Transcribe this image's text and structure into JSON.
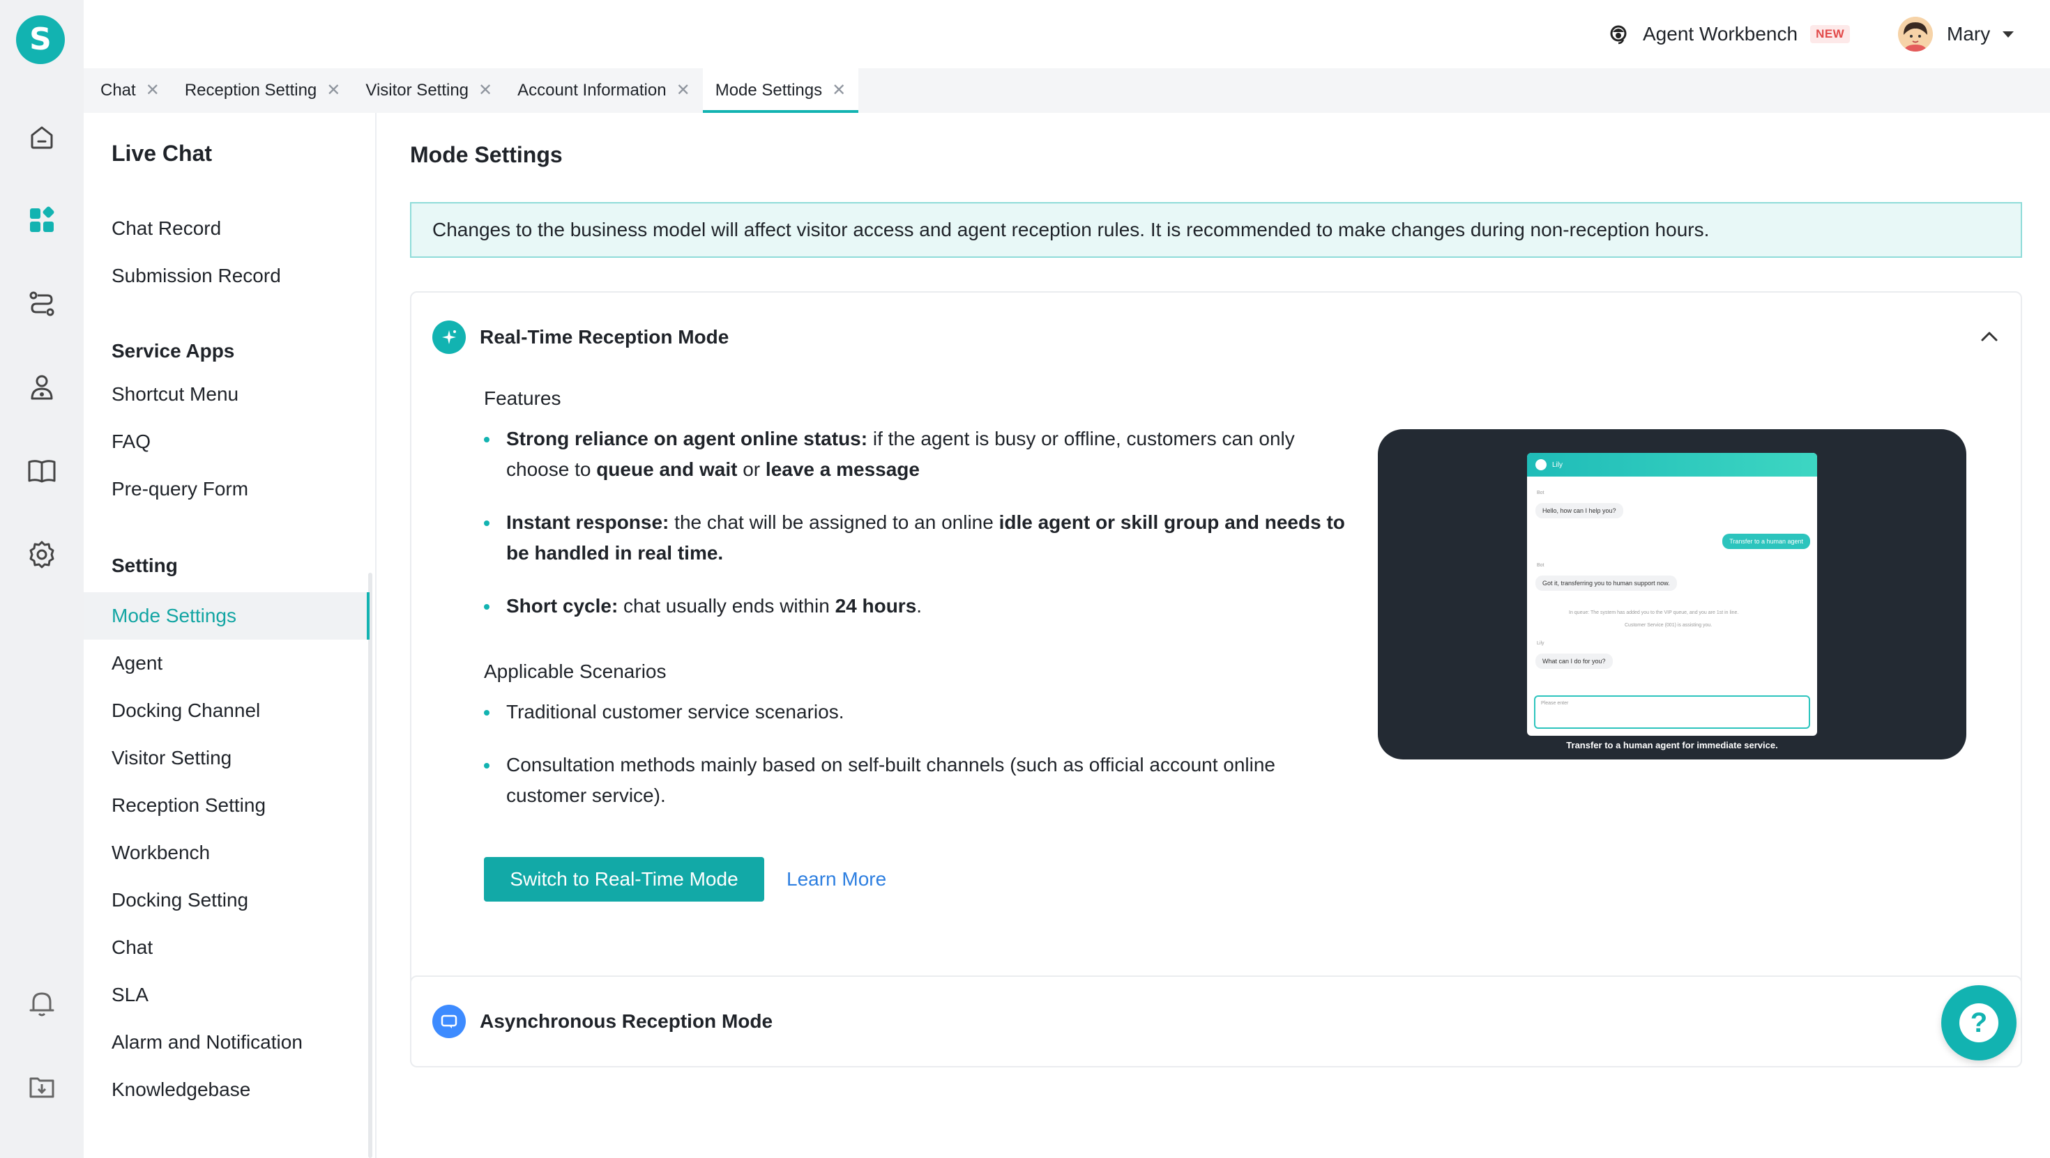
{
  "app": {
    "logo_letter": "S",
    "brand_color": "#12b3b1"
  },
  "rail": {
    "icons": [
      "home-icon",
      "apps-icon",
      "route-icon",
      "user-settings-icon",
      "book-icon",
      "gear-icon",
      "bell-icon",
      "download-icon"
    ]
  },
  "header": {
    "workbench_label": "Agent Workbench",
    "new_badge": "NEW",
    "user_name": "Mary"
  },
  "tabs": [
    {
      "label": "Chat",
      "active": false
    },
    {
      "label": "Reception Setting",
      "active": false
    },
    {
      "label": "Visitor Setting",
      "active": false
    },
    {
      "label": "Account Information",
      "active": false
    },
    {
      "label": "Mode Settings",
      "active": true
    }
  ],
  "sidebar": {
    "title": "Live Chat",
    "items_top": [
      "Chat Record",
      "Submission Record"
    ],
    "group_service": "Service Apps",
    "items_service": [
      "Shortcut Menu",
      "FAQ",
      "Pre-query Form"
    ],
    "group_setting": "Setting",
    "items_setting": [
      "Mode Settings",
      "Agent",
      "Docking Channel",
      "Visitor Setting",
      "Reception Setting",
      "Workbench",
      "Docking Setting",
      "Chat",
      "SLA",
      "Alarm and Notification",
      "Knowledgebase"
    ],
    "active_item": "Mode Settings"
  },
  "main": {
    "page_title": "Mode Settings",
    "notice": "Changes to the business model will affect visitor access and agent reception rules. It is recommended to make changes during non-reception hours.",
    "realtime": {
      "title": "Real-Time Reception Mode",
      "features_title": "Features",
      "features": [
        {
          "bold": "Strong reliance on agent online status:",
          "text": " if the agent is busy or offline, customers can only choose to ",
          "bold2": "queue and wait",
          "text2": " or ",
          "bold3": "leave a message",
          "text3": ""
        },
        {
          "bold": "Instant response:",
          "text": " the chat will be assigned to an online ",
          "bold2": "idle agent or skill group and needs to be handled in real time.",
          "text2": "",
          "bold3": "",
          "text3": ""
        },
        {
          "bold": "Short cycle:",
          "text": " chat usually ends within ",
          "bold2": "24 hours",
          "text2": ".",
          "bold3": "",
          "text3": ""
        }
      ],
      "scenarios_title": "Applicable Scenarios",
      "scenarios": [
        "Traditional customer service scenarios.",
        "Consultation methods mainly based on self-built channels (such as official account online customer service)."
      ],
      "switch_button": "Switch to Real-Time Mode",
      "learn_more": "Learn More",
      "preview": {
        "header_name": "Lily",
        "bot_label": "Bot",
        "bot_msg1": "Hello, how can I help you?",
        "user_msg": "Transfer to a human agent",
        "bot_msg2": "Got it, transferring you to human support now.",
        "system_msg1": "In queue: The system has added you to the VIP queue, and you are 1st in line.",
        "system_msg2": "Customer Service (001) is assisting you.",
        "agent_label": "Lily",
        "agent_msg": "What can I do for you?",
        "input_placeholder": "Please enter",
        "caption": "Transfer to a human agent for immediate service."
      }
    },
    "async": {
      "title": "Asynchronous Reception Mode"
    }
  },
  "help_button": "?"
}
